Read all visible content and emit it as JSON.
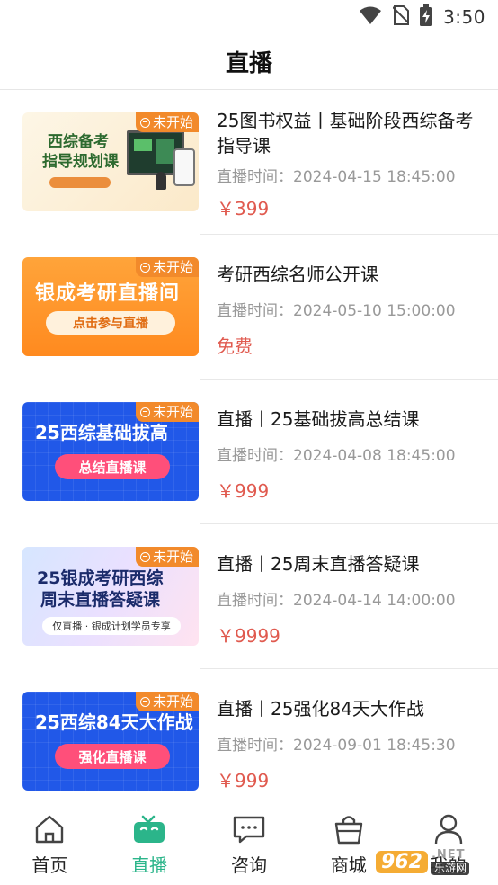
{
  "status_bar": {
    "time": "3:50"
  },
  "header": {
    "title": "直播"
  },
  "courses": [
    {
      "title": "25图书权益丨基础阶段西综备考指导课",
      "time_label": "直播时间：",
      "time": "2024-04-15 18:45:00",
      "price": "￥399",
      "badge": "未开始",
      "thumb": {
        "line1": "西综备考",
        "line2": "指导规划课"
      }
    },
    {
      "title": "考研西综名师公开课",
      "time_label": "直播时间：",
      "time": "2024-05-10 15:00:00",
      "price": "免费",
      "badge": "未开始",
      "thumb": {
        "line1": "银成考研直播间",
        "button": "点击参与直播"
      }
    },
    {
      "title": "直播丨25基础拔高总结课",
      "time_label": "直播时间：",
      "time": "2024-04-08 18:45:00",
      "price": "￥999",
      "badge": "未开始",
      "thumb": {
        "line1": "25西综基础拔高",
        "button": "总结直播课"
      }
    },
    {
      "title": "直播丨25周末直播答疑课",
      "time_label": "直播时间：",
      "time": "2024-04-14 14:00:00",
      "price": "￥9999",
      "badge": "未开始",
      "thumb": {
        "line1": "25银成考研西综",
        "line2": "周末直播答疑课",
        "bar": "仅直播 · 银成计划学员专享"
      }
    },
    {
      "title": "直播丨25强化84天大作战",
      "time_label": "直播时间：",
      "time": "2024-09-01 18:45:30",
      "price": "￥999",
      "badge": "未开始",
      "thumb": {
        "line1": "25西综84天大作战",
        "button": "强化直播课"
      }
    }
  ],
  "tabbar": {
    "items": [
      {
        "label": "首页",
        "icon": "home-icon"
      },
      {
        "label": "直播",
        "icon": "tv-icon",
        "active": true
      },
      {
        "label": "咨询",
        "icon": "chat-icon"
      },
      {
        "label": "商城",
        "icon": "shopping-bag-icon"
      },
      {
        "label": "我的",
        "icon": "user-icon"
      }
    ]
  },
  "watermark": {
    "number": "962",
    "brand": ".NET",
    "sub": "乐游网"
  },
  "colors": {
    "accent": "#2bb58a",
    "price": "#e05a4f",
    "badge": "#f28a2b"
  }
}
